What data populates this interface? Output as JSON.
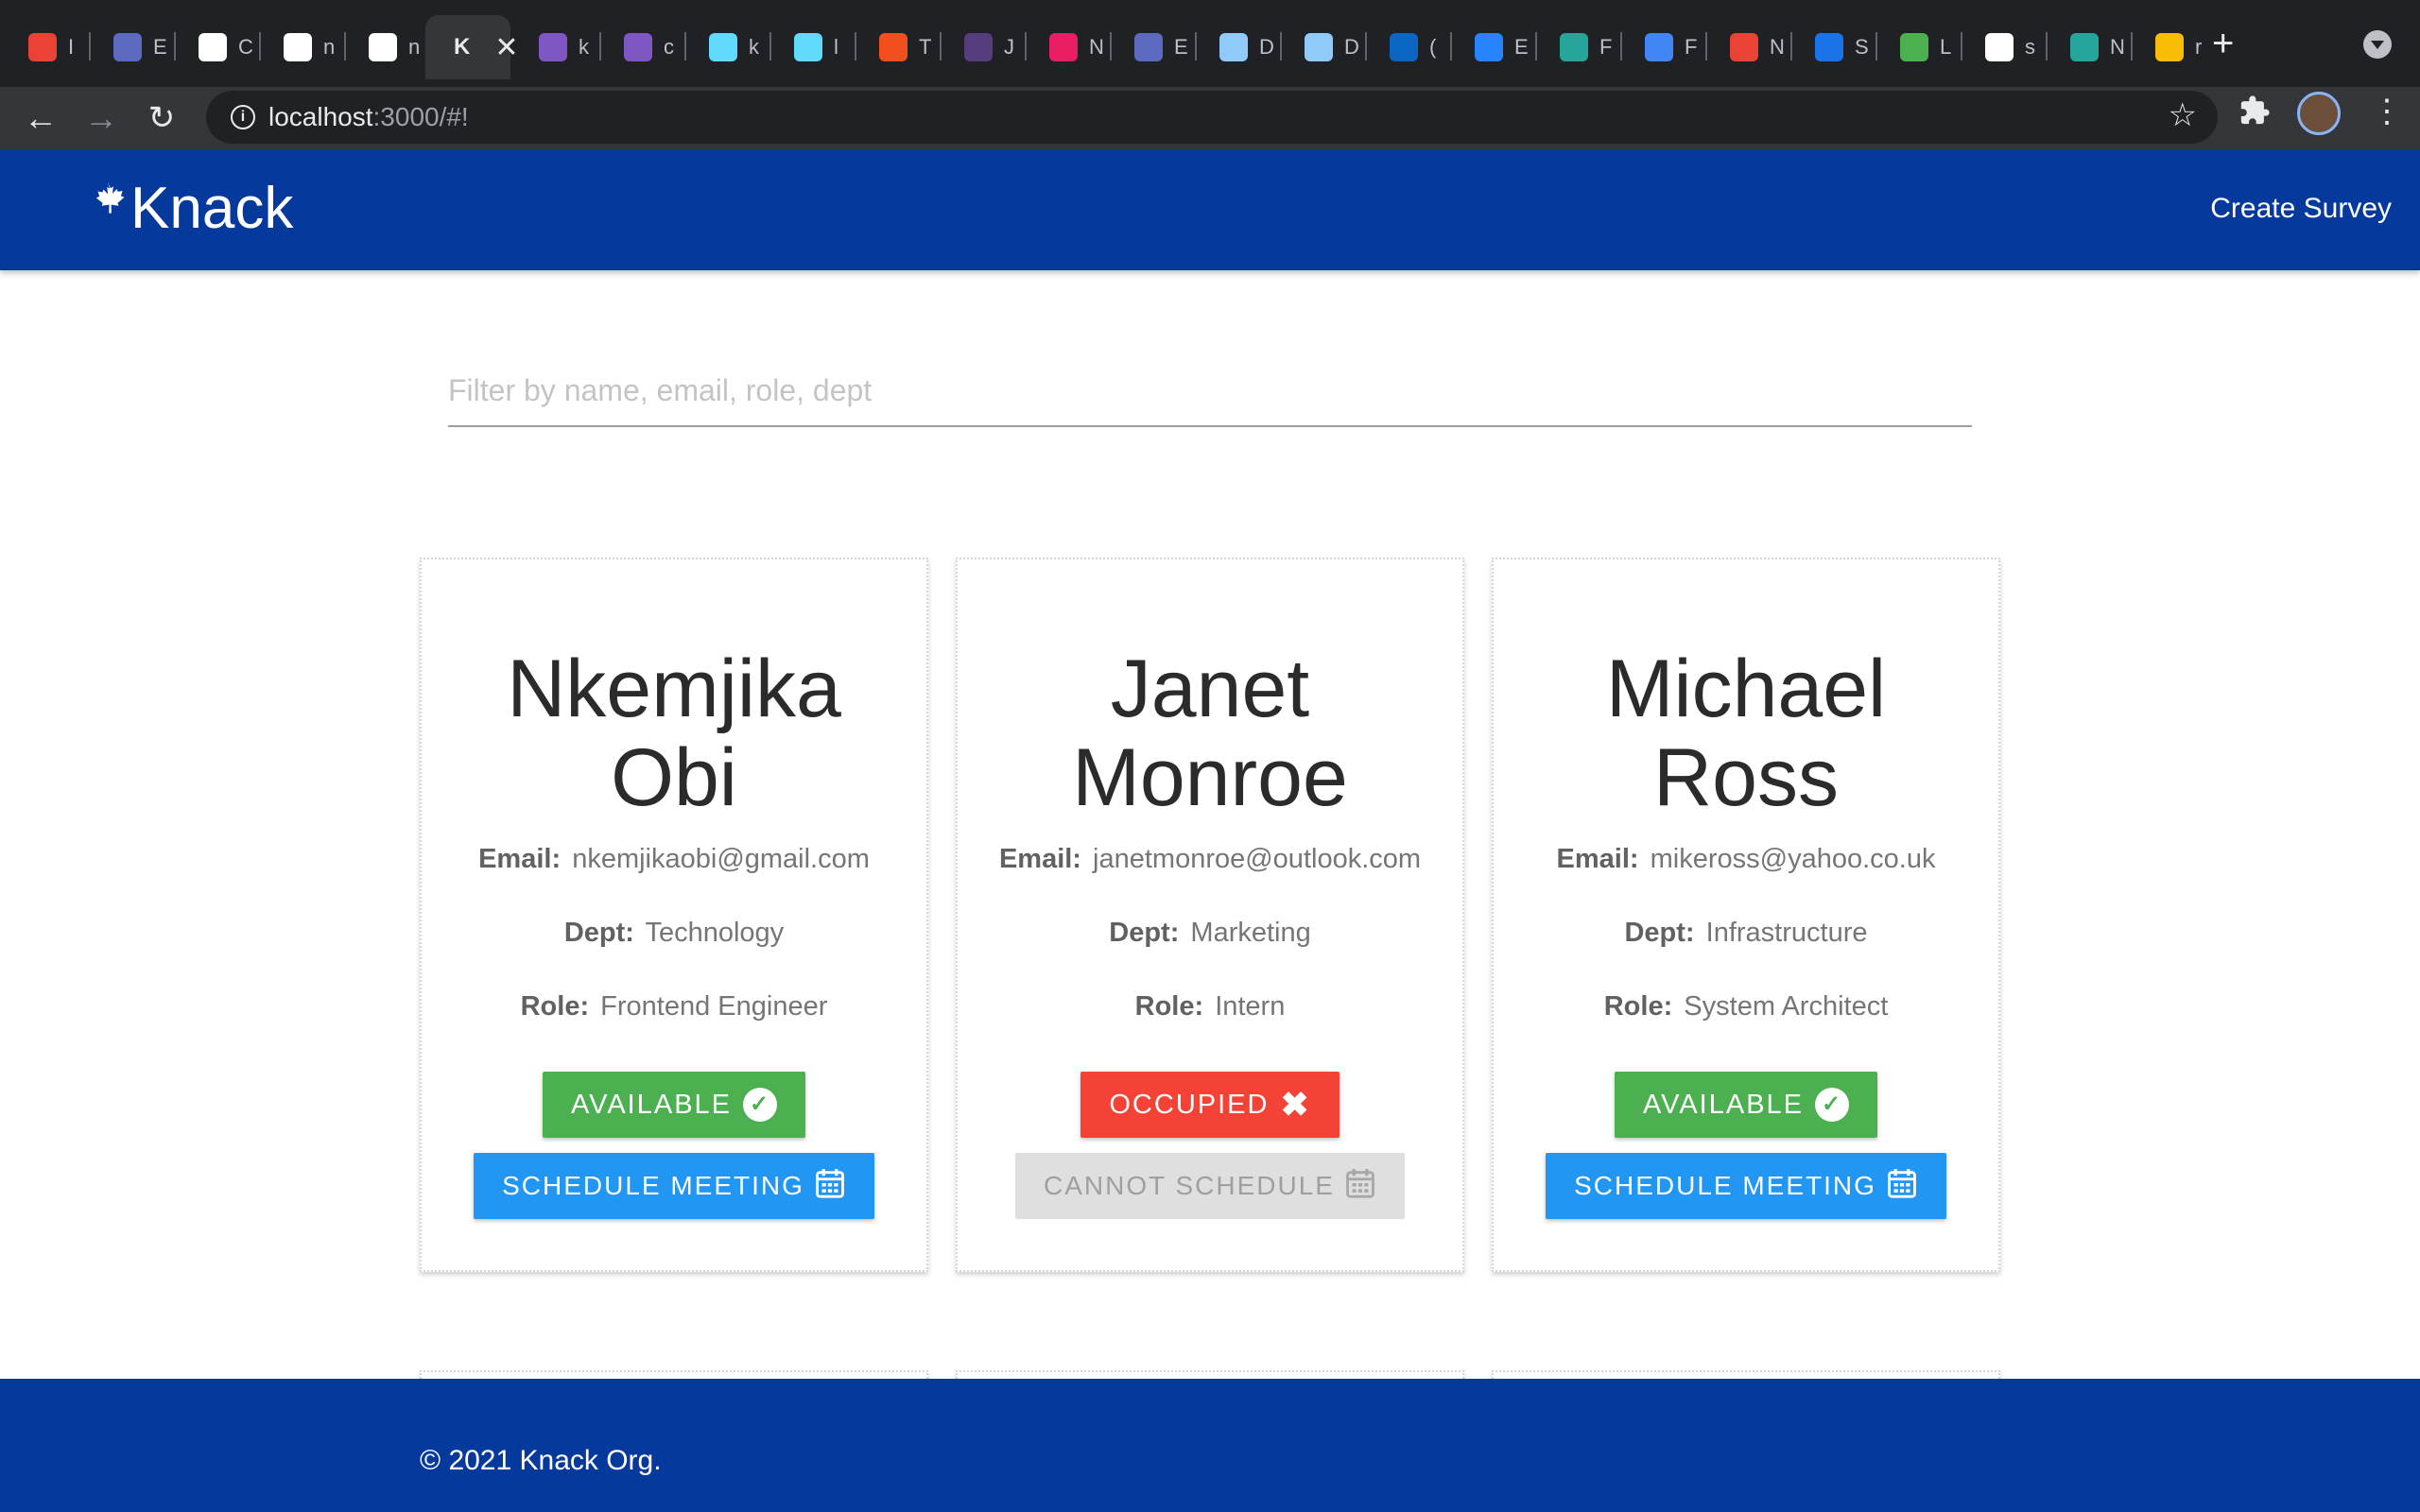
{
  "browser": {
    "tabs": [
      {
        "letter": "I",
        "color": "#ea4335"
      },
      {
        "letter": "E",
        "color": "#5c6bc0"
      },
      {
        "letter": "C",
        "color": "#ffffff"
      },
      {
        "letter": "n",
        "color": "#ffffff"
      },
      {
        "letter": "n",
        "color": "#ffffff"
      },
      {
        "letter": "K",
        "color": "#ffffff",
        "active": true
      },
      {
        "letter": "k",
        "color": "#7e57c2"
      },
      {
        "letter": "c",
        "color": "#7e57c2"
      },
      {
        "letter": "k",
        "color": "#61dafb"
      },
      {
        "letter": "l",
        "color": "#61dafb"
      },
      {
        "letter": "T",
        "color": "#f24e1e"
      },
      {
        "letter": "J",
        "color": "#563d7c"
      },
      {
        "letter": "N",
        "color": "#e91e63"
      },
      {
        "letter": "E",
        "color": "#5c6bc0"
      },
      {
        "letter": "D",
        "color": "#90caf9"
      },
      {
        "letter": "D",
        "color": "#90caf9"
      },
      {
        "letter": "(",
        "color": "#0a66c2"
      },
      {
        "letter": "E",
        "color": "#2684ff"
      },
      {
        "letter": "F",
        "color": "#26a69a"
      },
      {
        "letter": "F",
        "color": "#4285f4"
      },
      {
        "letter": "N",
        "color": "#ea4335"
      },
      {
        "letter": "S",
        "color": "#1a73e8"
      },
      {
        "letter": "L",
        "color": "#4caf50"
      },
      {
        "letter": "s",
        "color": "#ffffff"
      },
      {
        "letter": "N",
        "color": "#26a69a"
      },
      {
        "letter": "r",
        "color": "#fbbc05"
      }
    ],
    "url_host": "localhost",
    "url_rest": ":3000/#!"
  },
  "header": {
    "brand": "Knack",
    "create_survey": "Create Survey"
  },
  "filter": {
    "placeholder": "Filter by name, email, role, dept"
  },
  "labels": {
    "email": "Email:",
    "dept": "Dept:",
    "role": "Role:"
  },
  "employees": [
    {
      "name": "Nkemjika Obi",
      "email": "nkemjikaobi@gmail.com",
      "dept": "Technology",
      "role": "Frontend Engineer",
      "status": "AVAILABLE",
      "action": "SCHEDULE MEETING"
    },
    {
      "name": "Janet Monroe",
      "email": "janetmonroe@outlook.com",
      "dept": "Marketing",
      "role": "Intern",
      "status": "OCCUPIED",
      "action": "CANNOT SCHEDULE"
    },
    {
      "name": "Michael Ross",
      "email": "mikeross@yahoo.co.uk",
      "dept": "Infrastructure",
      "role": "System Architect",
      "status": "AVAILABLE",
      "action": "SCHEDULE MEETING"
    }
  ],
  "footer": {
    "copyright": "© 2021 Knack Org."
  },
  "colors": {
    "brand_blue": "#053a9c",
    "available": "#4caf50",
    "occupied": "#f44336",
    "schedule": "#2196f3",
    "disabled": "#dfdfdf"
  }
}
